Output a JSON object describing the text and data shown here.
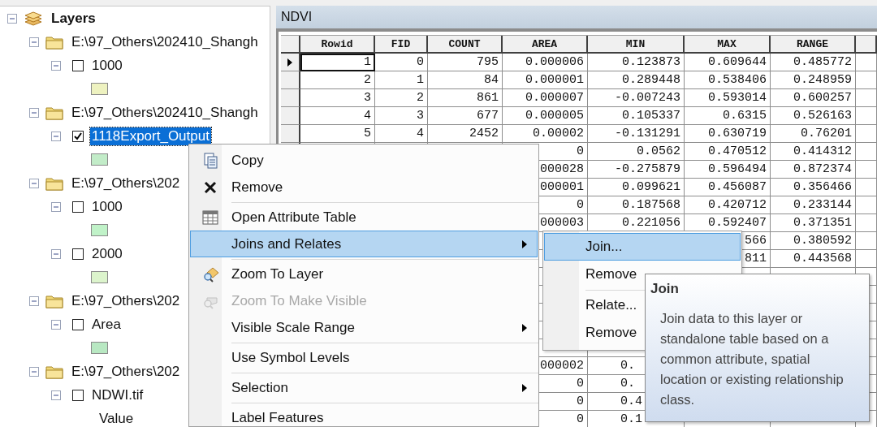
{
  "tree": {
    "label": "Layers",
    "expanded": true,
    "children": [
      {
        "label": "E:\\97_Others\\202410_Shangh",
        "expanded": true,
        "children": [
          {
            "label": "1000",
            "expanded": true,
            "checked": false,
            "selected": false,
            "legend": [
              {
                "kind": "swatch",
                "color": "#eef2c0"
              }
            ]
          }
        ]
      },
      {
        "label": "E:\\97_Others\\202410_Shangh",
        "expanded": true,
        "children": [
          {
            "label": "1118Export_Output",
            "expanded": true,
            "checked": true,
            "selected": true,
            "legend": [
              {
                "kind": "swatch",
                "color": "#c2ecc8"
              }
            ]
          }
        ]
      },
      {
        "label": "E:\\97_Others\\202",
        "expanded": true,
        "children": [
          {
            "label": "1000",
            "expanded": true,
            "checked": false,
            "selected": false,
            "legend": [
              {
                "kind": "swatch",
                "color": "#c0f2c8"
              }
            ]
          },
          {
            "label": "2000",
            "expanded": true,
            "checked": false,
            "selected": false,
            "legend": [
              {
                "kind": "swatch",
                "color": "#dcf4cc"
              }
            ]
          }
        ]
      },
      {
        "label": "E:\\97_Others\\202",
        "expanded": true,
        "children": [
          {
            "label": "Area",
            "expanded": true,
            "checked": false,
            "selected": false,
            "legend": [
              {
                "kind": "swatch",
                "color": "#b8e8c2"
              }
            ]
          }
        ]
      },
      {
        "label": "E:\\97_Others\\202",
        "expanded": true,
        "children": [
          {
            "label": "NDWI.tif",
            "expanded": true,
            "checked": false,
            "selected": false,
            "legend": [
              {
                "kind": "label",
                "label": "Value"
              }
            ]
          }
        ]
      }
    ]
  },
  "table_window": {
    "title": "NDVI",
    "columns": [
      "Rowid",
      "FID",
      "COUNT",
      "AREA",
      "MIN",
      "MAX",
      "RANGE"
    ],
    "rows": [
      {
        "current": true,
        "cells": [
          "1",
          "0",
          "795",
          "0.000006",
          "0.123873",
          "0.609644",
          "0.485772"
        ]
      },
      {
        "current": false,
        "cells": [
          "2",
          "1",
          "84",
          "0.000001",
          "0.289448",
          "0.538406",
          "0.248959"
        ]
      },
      {
        "current": false,
        "cells": [
          "3",
          "2",
          "861",
          "0.000007",
          "-0.007243",
          "0.593014",
          "0.600257"
        ]
      },
      {
        "current": false,
        "cells": [
          "4",
          "3",
          "677",
          "0.000005",
          "0.105337",
          "0.6315",
          "0.526163"
        ]
      },
      {
        "current": false,
        "cells": [
          "5",
          "4",
          "2452",
          "0.00002",
          "-0.131291",
          "0.630719",
          "0.76201"
        ]
      },
      {
        "cells": [
          null,
          null,
          null,
          "0",
          "0.0562",
          "0.470512",
          "0.414312"
        ]
      },
      {
        "cells": [
          null,
          null,
          null,
          "000028",
          "-0.275879",
          "0.596494",
          "0.872374"
        ]
      },
      {
        "cells": [
          null,
          null,
          null,
          "000001",
          "0.099621",
          "0.456087",
          "0.356466"
        ]
      },
      {
        "cells": [
          null,
          null,
          null,
          "0",
          "0.187568",
          "0.420712",
          "0.233144"
        ]
      },
      {
        "cells": [
          null,
          null,
          null,
          "000003",
          "0.221056",
          "0.592407",
          "0.371351"
        ]
      },
      {
        "cells": [
          null,
          null,
          null,
          null,
          null,
          "566",
          "0.380592"
        ]
      },
      {
        "cells": [
          null,
          null,
          null,
          null,
          null,
          "811",
          "0.443568"
        ]
      },
      {
        "cells": [
          null,
          null,
          null,
          null,
          null,
          null,
          null
        ]
      },
      {
        "cells": [
          null,
          null,
          null,
          null,
          null,
          null,
          null
        ]
      },
      {
        "cells": [
          null,
          null,
          null,
          null,
          null,
          null,
          null
        ]
      },
      {
        "cells": [
          null,
          null,
          null,
          null,
          null,
          null,
          null
        ]
      },
      {
        "cells": [
          null,
          null,
          null,
          null,
          null,
          null,
          null
        ]
      },
      {
        "cells": [
          null,
          null,
          null,
          "000002",
          {
            "kind": "clipped",
            "text": "0."
          },
          null,
          null
        ]
      },
      {
        "cells": [
          null,
          null,
          null,
          "0",
          {
            "kind": "clipped",
            "text": "0."
          },
          null,
          null
        ]
      },
      {
        "cells": [
          null,
          null,
          null,
          "0",
          {
            "kind": "clipped",
            "text": "0.4"
          },
          null,
          null
        ]
      },
      {
        "cells": [
          null,
          null,
          null,
          "0",
          {
            "kind": "clipped",
            "text": "0.1"
          },
          null,
          null
        ]
      }
    ]
  },
  "context_menu": {
    "items": [
      {
        "kind": "item",
        "label": "Copy",
        "icon": true,
        "disabled": false,
        "selected": false,
        "submenu": false
      },
      {
        "kind": "item",
        "label": "Remove",
        "icon": true,
        "disabled": false,
        "selected": false,
        "submenu": false
      },
      {
        "kind": "separator"
      },
      {
        "kind": "item",
        "label": "Open Attribute Table",
        "icon": true,
        "disabled": false,
        "selected": false,
        "submenu": false
      },
      {
        "kind": "item",
        "label": "Joins and Relates",
        "icon": false,
        "disabled": false,
        "selected": true,
        "submenu": true
      },
      {
        "kind": "separator"
      },
      {
        "kind": "item",
        "label": "Zoom To Layer",
        "icon": true,
        "disabled": false,
        "selected": false,
        "submenu": false
      },
      {
        "kind": "item",
        "label": "Zoom To Make Visible",
        "icon": true,
        "disabled": true,
        "selected": false,
        "submenu": false
      },
      {
        "kind": "item",
        "label": "Visible Scale Range",
        "icon": false,
        "disabled": false,
        "selected": false,
        "submenu": true
      },
      {
        "kind": "separator"
      },
      {
        "kind": "item",
        "label": "Use Symbol Levels",
        "icon": false,
        "disabled": false,
        "selected": false,
        "submenu": false
      },
      {
        "kind": "separator"
      },
      {
        "kind": "item",
        "label": "Selection",
        "icon": false,
        "disabled": false,
        "selected": false,
        "submenu": true
      },
      {
        "kind": "separator"
      },
      {
        "kind": "item",
        "label": "Label Features",
        "icon": false,
        "disabled": false,
        "selected": false,
        "submenu": false
      }
    ]
  },
  "submenu": {
    "items": [
      {
        "kind": "item",
        "label": "Join...",
        "selected": true
      },
      {
        "kind": "item",
        "label": "Remove",
        "selected": false
      },
      {
        "kind": "separator"
      },
      {
        "kind": "item",
        "label": "Relate...",
        "selected": false
      },
      {
        "kind": "item",
        "label": "Remove",
        "selected": false
      }
    ]
  },
  "tooltip": {
    "title": "Join",
    "text": "Join data to this layer or standalone table based on a common attribute, spatial location or existing relationship class."
  }
}
